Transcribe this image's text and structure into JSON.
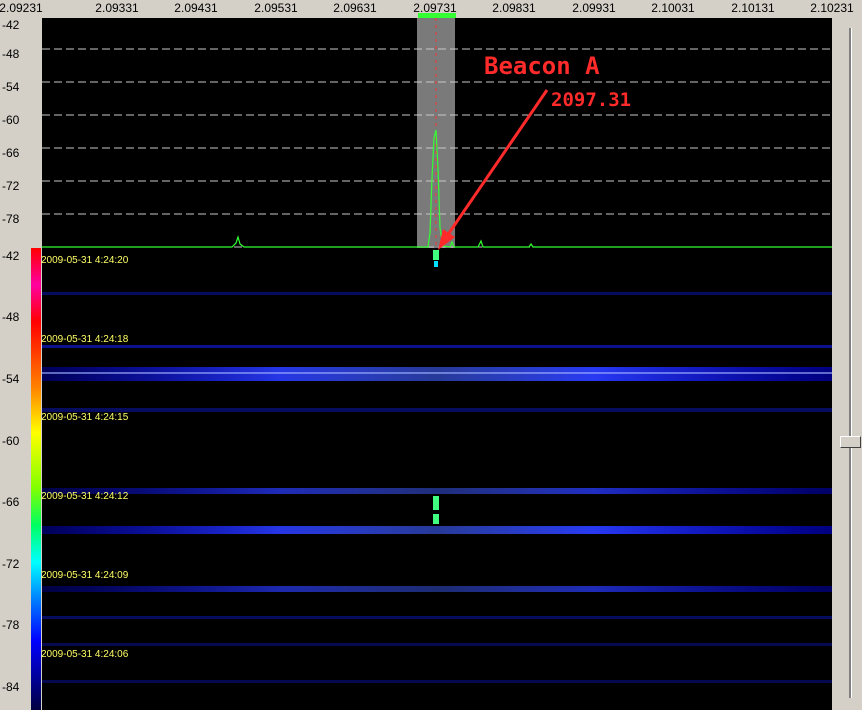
{
  "frequency_axis": [
    "2.09231",
    "2.09331",
    "2.09431",
    "2.09531",
    "2.09631",
    "2.09731",
    "2.09831",
    "2.09931",
    "2.10031",
    "2.10131",
    "2.10231"
  ],
  "spectrum_db_labels": [
    "-42",
    "-48",
    "-54",
    "-60",
    "-66",
    "-72",
    "-78"
  ],
  "waterfall_db_labels": [
    "-42",
    "-48",
    "-54",
    "-60",
    "-66",
    "-72",
    "-78",
    "-84"
  ],
  "timestamps": [
    "2009-05-31 4:24:20",
    "2009-05-31 4:24:18",
    "2009-05-31 4:24:15",
    "2009-05-31 4:24:12",
    "2009-05-31 4:24:09",
    "2009-05-31 4:24:06"
  ],
  "annotation": {
    "title": "Beacon A",
    "frequency": "2097.31"
  },
  "colors": {
    "trace": "#33ff33",
    "annotation": "#ff2a2a",
    "band_highlight": "#7a7a7a",
    "timestamp": "#ffff66"
  }
}
